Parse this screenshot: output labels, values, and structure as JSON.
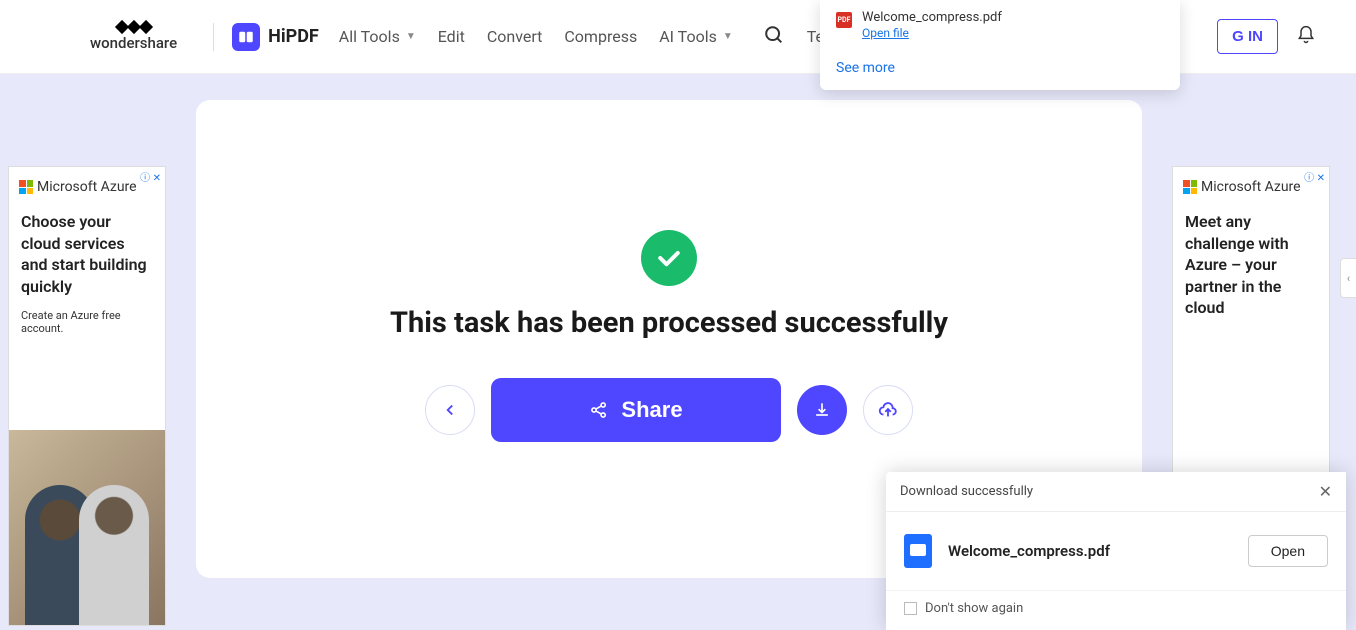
{
  "header": {
    "wondershare": "wondershare",
    "hipdf": "HiPDF",
    "nav": {
      "all_tools": "All Tools",
      "edit": "Edit",
      "convert": "Convert",
      "compress": "Compress",
      "ai_tools": "AI Tools",
      "templates": "Ter"
    },
    "signin": "G IN"
  },
  "dl": {
    "file": "Welcome_compress.pdf",
    "open": "Open file",
    "more": "See more",
    "chip": "PDF"
  },
  "main": {
    "title": "This task has been processed successfully",
    "share": "Share"
  },
  "ads": {
    "brand": "Microsoft Azure",
    "left_head": "Choose your cloud services and start building quickly",
    "left_sub": "Create an Azure free account.",
    "right_head": "Meet any challenge with Azure – your partner in the cloud"
  },
  "toast": {
    "title": "Download successfully",
    "file": "Welcome_compress.pdf",
    "open": "Open",
    "dont": "Don't show again"
  }
}
